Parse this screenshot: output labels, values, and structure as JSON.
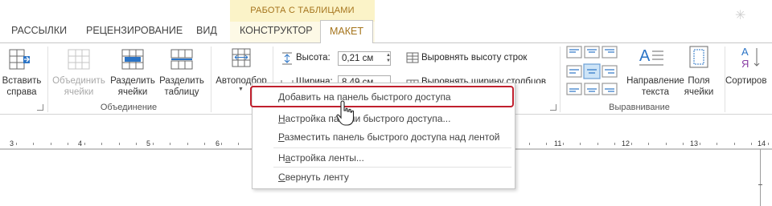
{
  "context_tab": {
    "label": "РАБОТА С ТАБЛИЦАМИ"
  },
  "tabs": [
    {
      "label": "РАССЫЛКИ"
    },
    {
      "label": "РЕЦЕНЗИРОВАНИЕ"
    },
    {
      "label": "ВИД"
    },
    {
      "label": "КОНСТРУКТОР"
    },
    {
      "label": "МАКЕТ"
    }
  ],
  "ribbon": {
    "insert_right": {
      "line1": "Вставить",
      "line2": "справа"
    },
    "merge_cells": {
      "line1": "Объединить",
      "line2": "ячейки"
    },
    "split_cells": {
      "line1": "Разделить",
      "line2": "ячейки"
    },
    "split_table": {
      "line1": "Разделить",
      "line2": "таблицу"
    },
    "merge_group": "Объединение",
    "autofit": {
      "label": "Автоподбор"
    },
    "height": {
      "label": "Высота:",
      "value": "0,21 см"
    },
    "width": {
      "label": "Ширина:",
      "value": "8,49 см"
    },
    "distribute_rows": "Выровнять высоту строк",
    "distribute_cols": "Выровнять ширину столбцов",
    "text_direction": {
      "line1": "Направление",
      "line2": "текста"
    },
    "cell_margins": {
      "line1": "Поля",
      "line2": "ячейки"
    },
    "alignment_group": "Выравнивание",
    "sort": {
      "label": "Сортиров"
    }
  },
  "ruler": {
    "labels": [
      "3",
      "4",
      "5",
      "6",
      "11",
      "12",
      "13",
      "14"
    ]
  },
  "context_menu": {
    "items": [
      {
        "prefix": "",
        "accel": "Д",
        "rest": "обавить на панель быстрого доступа"
      },
      {
        "prefix": "",
        "accel": "Н",
        "rest": "астройка панели быстрого доступа..."
      },
      {
        "prefix": "",
        "accel": "Р",
        "rest": "азместить панель быстрого доступа над лентой"
      },
      {
        "prefix": "Н",
        "accel": "а",
        "rest": "стройка ленты..."
      },
      {
        "prefix": "",
        "accel": "С",
        "rest": "вернуть ленту"
      }
    ]
  },
  "colors": {
    "highlight": "#c0202e",
    "context_accent": "#a5741c",
    "context_band": "#fbf3c8"
  }
}
